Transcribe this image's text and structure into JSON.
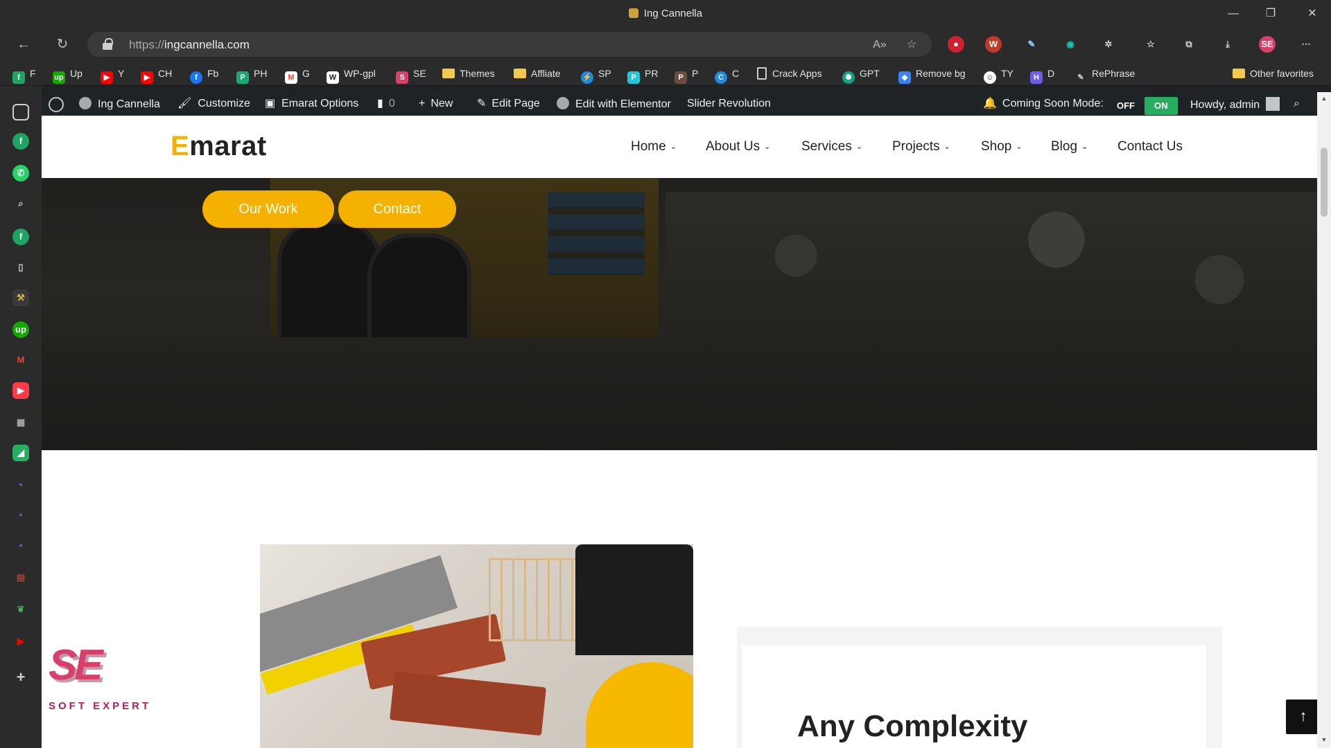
{
  "window": {
    "title": "Ing Cannella"
  },
  "browser": {
    "url_proto": "https://",
    "url_host": "ingcannella.com",
    "bookmarks": [
      {
        "label": "F",
        "icon": "green-f-icon",
        "color": "#1fa463"
      },
      {
        "label": "Up",
        "icon": "upwork-icon",
        "color": "#14a800"
      },
      {
        "label": "Y",
        "icon": "youtube-icon",
        "color": "#ff0000"
      },
      {
        "label": "CH",
        "icon": "youtube-icon",
        "color": "#ff0000"
      },
      {
        "label": "Fb",
        "icon": "facebook-icon",
        "color": "#1877f2"
      },
      {
        "label": "PH",
        "icon": "ph-icon",
        "color": "#19a974"
      },
      {
        "label": "G",
        "icon": "gmail-icon",
        "color": "#ea4335"
      },
      {
        "label": "WP-gpl",
        "icon": "wp-gpl-icon",
        "color": "#ffffff"
      },
      {
        "label": "SE",
        "icon": "se-icon",
        "color": "#d8406a"
      },
      {
        "label": "Themes",
        "icon": "folder-icon",
        "color": "#f2c94c"
      },
      {
        "label": "Affliate",
        "icon": "folder-icon",
        "color": "#f2c94c"
      },
      {
        "label": "SP",
        "icon": "sp-icon",
        "color": "#1e88e5"
      },
      {
        "label": "PR",
        "icon": "pr-icon",
        "color": "#26c6da"
      },
      {
        "label": "P",
        "icon": "p-icon",
        "color": "#6d4c41"
      },
      {
        "label": "C",
        "icon": "c-icon",
        "color": "#1e88e5"
      },
      {
        "label": "Crack Apps",
        "icon": "document-icon",
        "color": "#cfcfcf"
      },
      {
        "label": "GPT",
        "icon": "chatgpt-icon",
        "color": "#10a37f"
      },
      {
        "label": "Remove bg",
        "icon": "removebg-icon",
        "color": "#3b82f6"
      },
      {
        "label": "TY",
        "icon": "ty-icon",
        "color": "#ffffff"
      },
      {
        "label": "D",
        "icon": "d-icon",
        "color": "#6c5ce7"
      },
      {
        "label": "RePhrase",
        "icon": "rephrase-icon",
        "color": "#cfcfcf"
      },
      {
        "label": "Other favorites",
        "icon": "folder-icon",
        "color": "#f2c94c"
      }
    ]
  },
  "wp_admin_bar": {
    "site_name": "Ing Cannella",
    "customize": "Customize",
    "options": "Emarat Options",
    "comments": "0",
    "new": "New",
    "edit_page": "Edit Page",
    "elementor": "Edit with Elementor",
    "slider": "Slider Revolution",
    "coming_soon": "Coming Soon Mode:",
    "off": "OFF",
    "on": "ON",
    "howdy": "Howdy, admin"
  },
  "site": {
    "logo_first": "E",
    "logo_rest": "marat",
    "nav": [
      "Home",
      "About Us",
      "Services",
      "Projects",
      "Shop",
      "Blog",
      "Contact Us"
    ],
    "hero_buttons": [
      "Our Work",
      "Contact"
    ],
    "headline": "Any Complexity",
    "accent_color": "#f5b100"
  },
  "watermark": {
    "mark": "SE",
    "text": "SOFT EXPERT"
  }
}
